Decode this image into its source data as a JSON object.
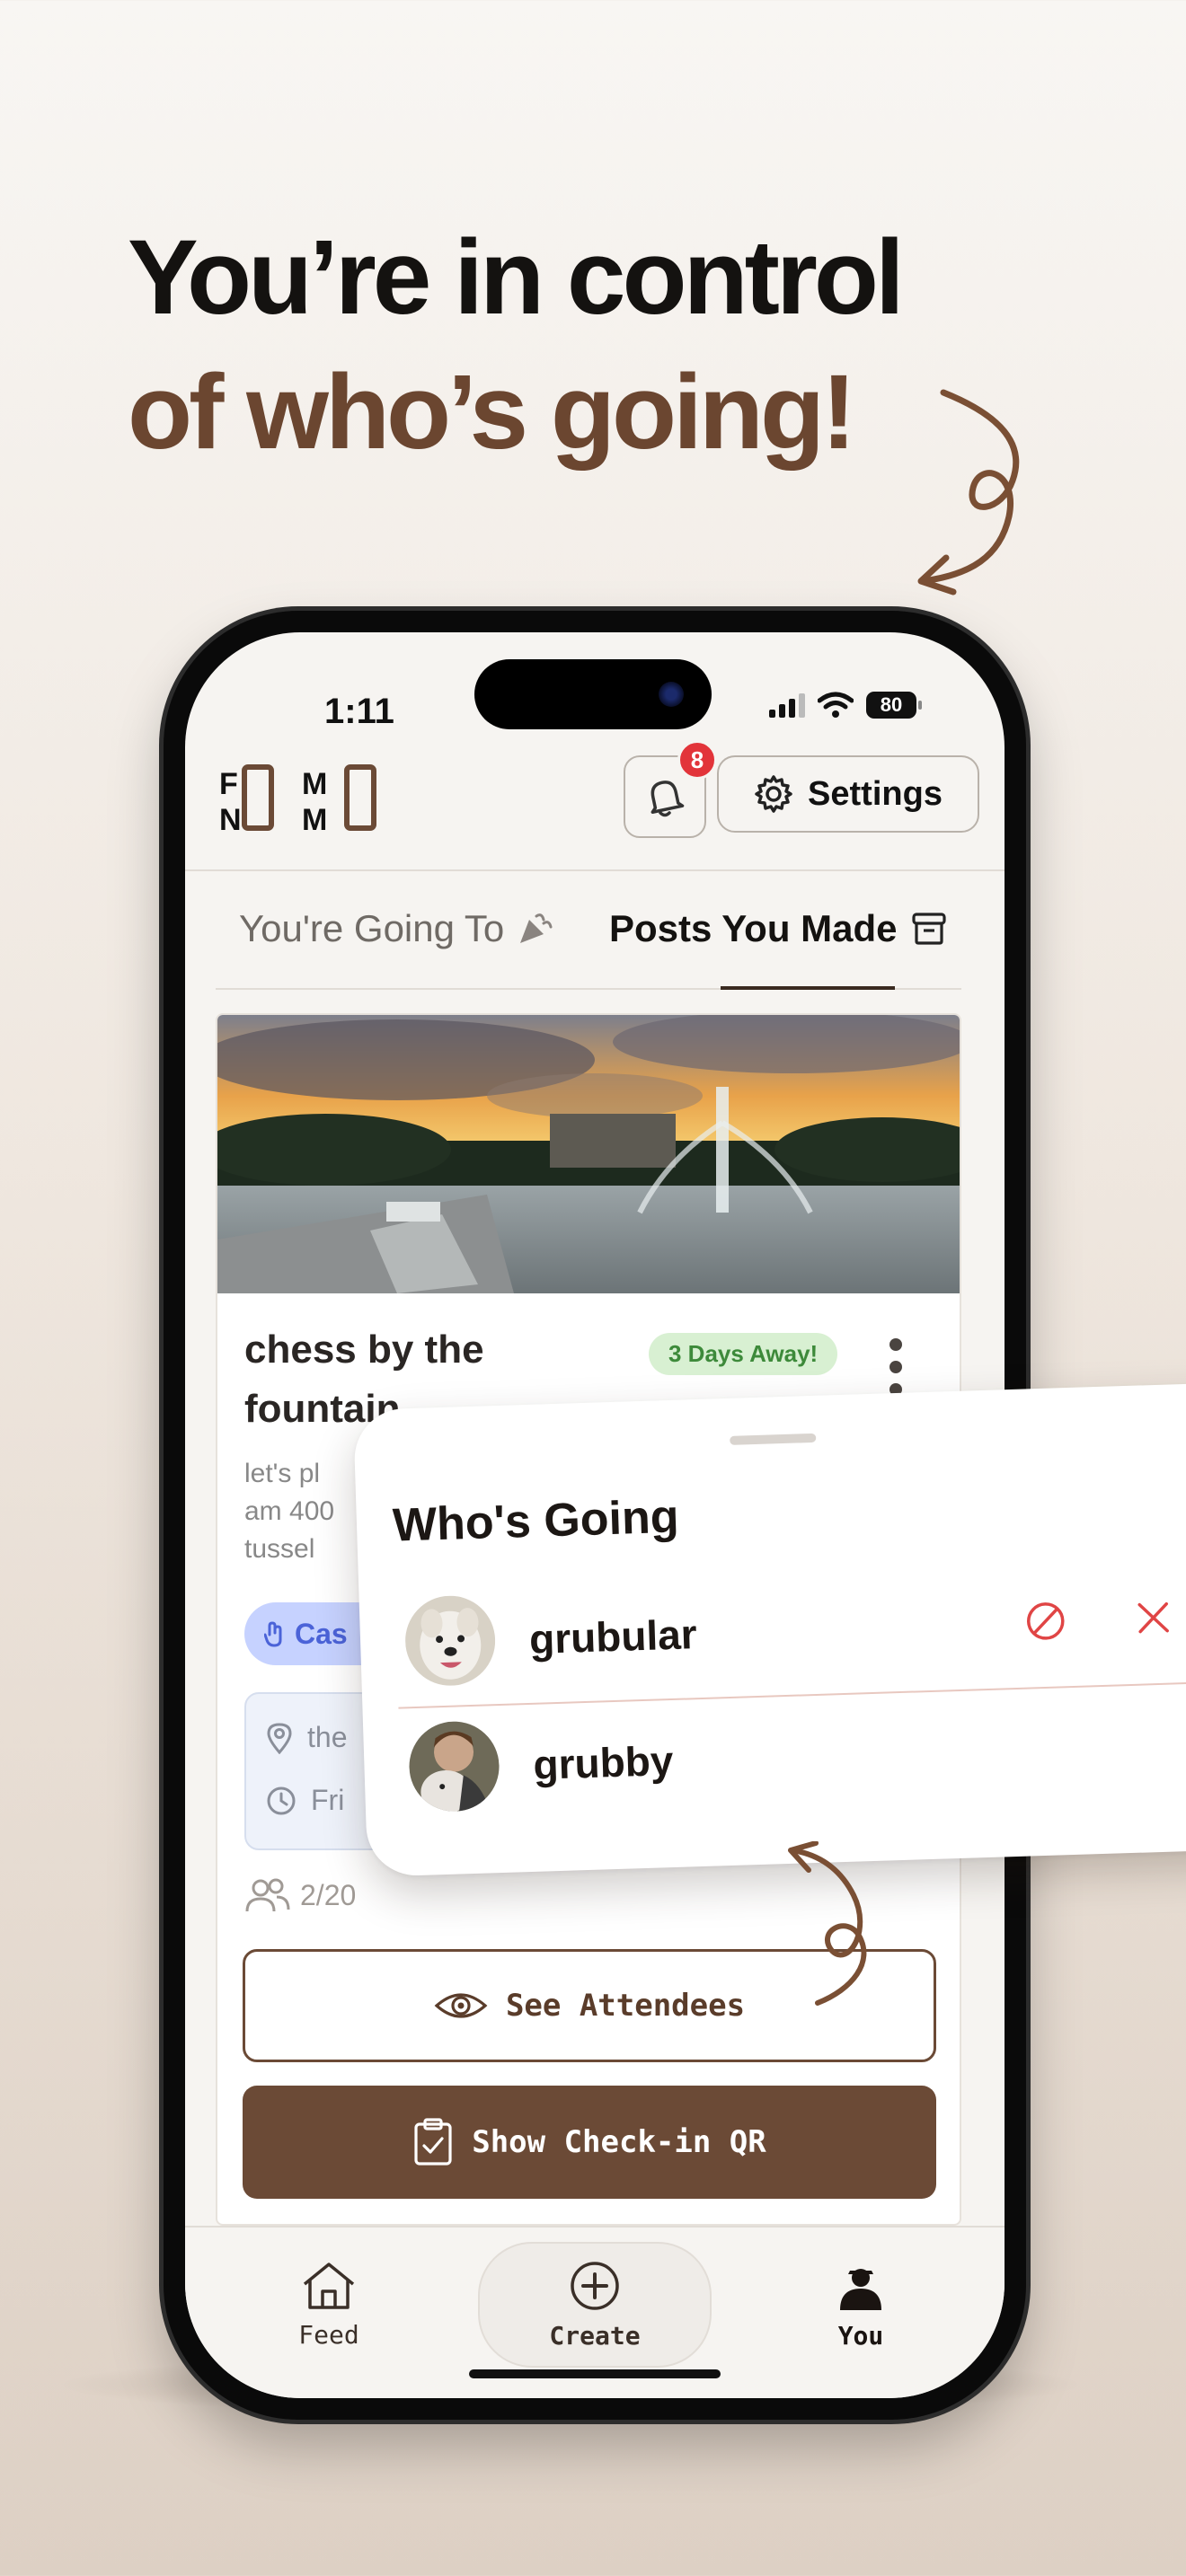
{
  "headline": {
    "line1": "You’re in control",
    "line2": "of who’s going!"
  },
  "status_bar": {
    "time": "1:11",
    "battery": "80"
  },
  "header": {
    "logo_text": "FOMO NOMO",
    "notification_count": "8",
    "settings_label": "Settings"
  },
  "tabs": [
    {
      "label": "You're Going To"
    },
    {
      "label": "Posts You Made"
    }
  ],
  "event_card": {
    "title": "chess by the fountain",
    "badge": "3 Days Away!",
    "description": "let's pl\nam 400\ntussel",
    "tag": "Cas",
    "location": "the",
    "time": "Fri",
    "stats": "2/20",
    "see_attendees_label": "See Attendees",
    "show_qr_label": "Show Check-in QR"
  },
  "whos_going": {
    "title": "Who's Going",
    "attendees": [
      {
        "name": "grubular"
      },
      {
        "name": "grubby"
      }
    ]
  },
  "bottom_nav": [
    {
      "label": "Feed",
      "icon": "home-icon"
    },
    {
      "label": "Create",
      "icon": "plus-circle-icon"
    },
    {
      "label": "You",
      "icon": "person-icon"
    }
  ],
  "colors": {
    "brand_brown": "#6b4a36",
    "headline_brown": "#6b4630",
    "badge_green_bg": "#d8f0d2",
    "notification_red": "#e2343a",
    "tag_blue_bg": "#c6d2ff",
    "remove_red": "#e04545"
  }
}
